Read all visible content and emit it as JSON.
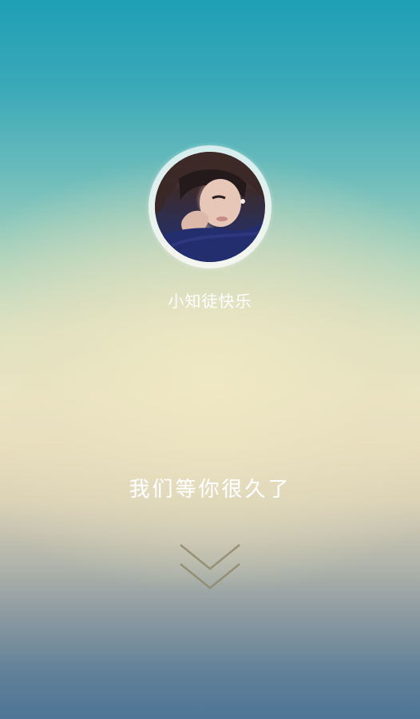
{
  "profile": {
    "username": "小知徒快乐"
  },
  "welcome": {
    "tagline": "我们等你很久了"
  },
  "icons": {
    "avatar": "user-avatar-photo",
    "scroll": "double-chevron-down-icon"
  },
  "colors": {
    "top": "#1f9fb5",
    "middle": "#ece6c4",
    "bottom": "#4f7697",
    "chevron": "#8f8a6a",
    "text": "#ffffff"
  }
}
